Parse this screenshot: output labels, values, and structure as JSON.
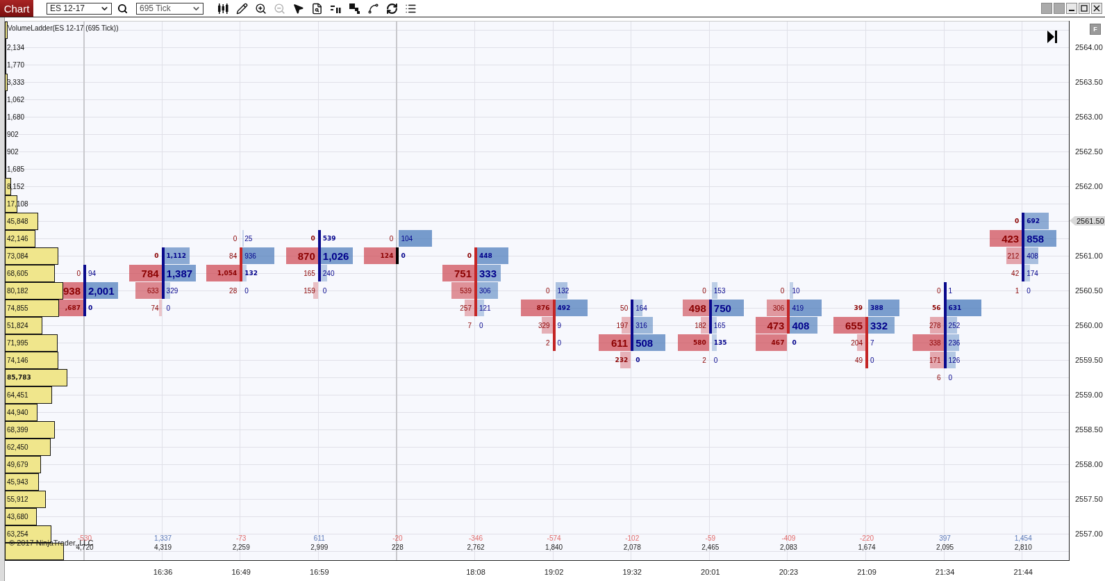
{
  "toolbar": {
    "chart_button": "Chart",
    "instrument": "ES 12-17",
    "interval": "695 Tick",
    "tools": [
      {
        "kind": "candles",
        "disabled": false
      },
      {
        "kind": "pencil",
        "disabled": false
      },
      {
        "kind": "zoom-in",
        "disabled": false
      },
      {
        "kind": "zoom-out",
        "disabled": true
      },
      {
        "kind": "pointer",
        "disabled": false
      },
      {
        "kind": "data-box",
        "disabled": false
      },
      {
        "kind": "ladder",
        "disabled": false
      },
      {
        "kind": "squares",
        "disabled": false
      },
      {
        "kind": "nodes",
        "disabled": false
      },
      {
        "kind": "refresh",
        "disabled": false
      },
      {
        "kind": "list",
        "disabled": false
      }
    ]
  },
  "chart": {
    "title": "VolumeLadder(ES 12-17 (695 Tick))",
    "flag_button": "F",
    "copyright": "© 2017 NinjaTrader, LLC",
    "price_axis": [
      {
        "price": "2564.00",
        "current": false
      },
      {
        "price": "2563.50",
        "current": false
      },
      {
        "price": "2563.00",
        "current": false
      },
      {
        "price": "2562.50",
        "current": false
      },
      {
        "price": "2562.00",
        "current": false
      },
      {
        "price": "2561.50",
        "current": true
      },
      {
        "price": "2561.00",
        "current": false
      },
      {
        "price": "2560.50",
        "current": false
      },
      {
        "price": "2560.00",
        "current": false
      },
      {
        "price": "2559.50",
        "current": false
      },
      {
        "price": "2559.00",
        "current": false
      },
      {
        "price": "2558.50",
        "current": false
      },
      {
        "price": "2558.00",
        "current": false
      },
      {
        "price": "2557.50",
        "current": false
      },
      {
        "price": "2557.00",
        "current": false
      }
    ],
    "profile": [
      {
        "level": 0.045
      },
      {
        "volume": "2,134",
        "level": 0.025,
        "poc": false
      },
      {
        "volume": "1,770",
        "level": 0.021,
        "poc": false
      },
      {
        "volume": "3,333",
        "level": 0.039,
        "poc": false
      },
      {
        "volume": "1,062",
        "level": 0.012,
        "poc": false
      },
      {
        "volume": "1,680",
        "level": 0.02,
        "poc": false
      },
      {
        "volume": "902",
        "level": 0.011,
        "poc": false
      },
      {
        "volume": "902",
        "level": 0.011,
        "poc": false
      },
      {
        "volume": "1,685",
        "level": 0.02,
        "poc": false
      },
      {
        "volume": "8,152",
        "level": 0.095,
        "poc": false
      },
      {
        "volume": "17,108",
        "level": 0.2,
        "poc": false
      },
      {
        "volume": "45,848",
        "level": 0.53,
        "poc": false
      },
      {
        "volume": "42,146",
        "level": 0.49,
        "poc": false
      },
      {
        "volume": "73,084",
        "level": 0.85,
        "poc": false
      },
      {
        "volume": "68,605",
        "level": 0.8,
        "poc": false
      },
      {
        "volume": "80,182",
        "level": 0.93,
        "poc": false
      },
      {
        "volume": "74,855",
        "level": 0.87,
        "poc": false
      },
      {
        "volume": "51,824",
        "level": 0.6,
        "poc": false
      },
      {
        "volume": "71,995",
        "level": 0.84,
        "poc": false
      },
      {
        "volume": "74,146",
        "level": 0.86,
        "poc": false
      },
      {
        "volume": "85,783",
        "level": 1,
        "poc": true
      },
      {
        "volume": "64,451",
        "level": 0.75,
        "poc": false
      },
      {
        "volume": "44,940",
        "level": 0.52,
        "poc": false
      },
      {
        "volume": "68,399",
        "level": 0.8,
        "poc": false
      },
      {
        "volume": "62,450",
        "level": 0.73,
        "poc": false
      },
      {
        "volume": "49,679",
        "level": 0.58,
        "poc": false
      },
      {
        "volume": "45,943",
        "level": 0.54,
        "poc": false
      },
      {
        "volume": "55,912",
        "level": 0.65,
        "poc": false
      },
      {
        "volume": "43,680",
        "level": 0.51,
        "poc": false
      },
      {
        "volume": "63,254",
        "level": 0.74,
        "poc": false
      },
      {
        "level": 0.94
      }
    ],
    "columns": [
      {
        "session_break": true,
        "kind": "up",
        "delta": "-530",
        "delta_positive": false,
        "volume": "4,720",
        "levels": [
          {
            "kind": "gap"
          },
          {
            "kind": "gap"
          },
          {
            "kind": "gap"
          },
          {
            "kind": "gap"
          },
          {
            "kind": "gap"
          },
          {
            "kind": "gap"
          },
          {
            "kind": "gap"
          },
          {
            "kind": "gap"
          },
          {
            "kind": "gap"
          },
          {
            "kind": "gap"
          },
          {
            "kind": "gap"
          },
          {
            "kind": "gap"
          },
          {
            "kind": "gap"
          },
          {
            "kind": "gap"
          },
          {
            "kind": "cell",
            "bid": {
              "text": "0"
            },
            "ask": {
              "text": "94"
            },
            "poc": false,
            "bold": false,
            "body": true
          },
          {
            "kind": "cell",
            "bid": {
              "text": "938",
              "level": 0.46
            },
            "ask": {
              "text": "2,001",
              "level": 0.46
            },
            "poc": true,
            "bold": true,
            "body": true
          },
          {
            "kind": "cell",
            "bid": {
              "text": ",687",
              "level": 0.46
            },
            "ask": {
              "text": "0"
            },
            "poc": false,
            "bold": true,
            "body": true
          }
        ]
      },
      {
        "time": "16:36",
        "session_break": false,
        "kind": "up",
        "delta": "1,337",
        "delta_positive": true,
        "volume": "4,319",
        "levels": [
          {
            "kind": "gap"
          },
          {
            "kind": "gap"
          },
          {
            "kind": "gap"
          },
          {
            "kind": "gap"
          },
          {
            "kind": "gap"
          },
          {
            "kind": "gap"
          },
          {
            "kind": "gap"
          },
          {
            "kind": "gap"
          },
          {
            "kind": "gap"
          },
          {
            "kind": "gap"
          },
          {
            "kind": "gap"
          },
          {
            "kind": "gap"
          },
          {
            "kind": "gap"
          },
          {
            "kind": "cell",
            "bid": {
              "text": "0"
            },
            "ask": {
              "text": "1,112",
              "level": 0.36
            },
            "poc": false,
            "bold": true,
            "body": true
          },
          {
            "kind": "cell",
            "bid": {
              "text": "784",
              "level": 0.47
            },
            "ask": {
              "text": "1,387",
              "level": 0.45
            },
            "poc": true,
            "bold": true,
            "body": true
          },
          {
            "kind": "cell",
            "bid": {
              "text": "633",
              "level": 0.38
            },
            "ask": {
              "text": "329",
              "level": 0.08
            },
            "poc": false,
            "bold": false,
            "body": true
          },
          {
            "kind": "cell",
            "bid": {
              "text": "74",
              "level": 0.04
            },
            "ask": {
              "text": "0"
            },
            "poc": false,
            "bold": false,
            "body": false
          }
        ]
      },
      {
        "time": "16:49",
        "session_break": false,
        "kind": "down",
        "delta": "-73",
        "delta_positive": false,
        "volume": "2,259",
        "levels": [
          {
            "kind": "gap"
          },
          {
            "kind": "gap"
          },
          {
            "kind": "gap"
          },
          {
            "kind": "gap"
          },
          {
            "kind": "gap"
          },
          {
            "kind": "gap"
          },
          {
            "kind": "gap"
          },
          {
            "kind": "gap"
          },
          {
            "kind": "gap"
          },
          {
            "kind": "gap"
          },
          {
            "kind": "gap"
          },
          {
            "kind": "gap"
          },
          {
            "kind": "cell",
            "bid": {
              "text": "0"
            },
            "ask": {
              "text": "25",
              "level": 0.02
            },
            "poc": false,
            "bold": false,
            "body": false
          },
          {
            "kind": "cell",
            "bid": {
              "text": "84"
            },
            "ask": {
              "text": "936",
              "level": 0.46
            },
            "poc": false,
            "bold": false,
            "body": true
          },
          {
            "kind": "cell",
            "bid": {
              "text": "1,054",
              "level": 0.48
            },
            "ask": {
              "text": "132",
              "level": 0.06
            },
            "poc": false,
            "bold": true,
            "body": true
          },
          {
            "kind": "cell",
            "bid": {
              "text": "28"
            },
            "ask": {
              "text": "0"
            },
            "poc": false,
            "bold": false,
            "body": false
          }
        ]
      },
      {
        "time": "16:59",
        "session_break": false,
        "kind": "up",
        "delta": "611",
        "delta_positive": true,
        "volume": "2,999",
        "levels": [
          {
            "kind": "gap"
          },
          {
            "kind": "gap"
          },
          {
            "kind": "gap"
          },
          {
            "kind": "gap"
          },
          {
            "kind": "gap"
          },
          {
            "kind": "gap"
          },
          {
            "kind": "gap"
          },
          {
            "kind": "gap"
          },
          {
            "kind": "gap"
          },
          {
            "kind": "gap"
          },
          {
            "kind": "gap"
          },
          {
            "kind": "gap"
          },
          {
            "kind": "cell",
            "bid": {
              "text": "0"
            },
            "ask": {
              "text": "539"
            },
            "poc": false,
            "bold": true,
            "body": true
          },
          {
            "kind": "cell",
            "bid": {
              "text": "870",
              "level": 0.46
            },
            "ask": {
              "text": "1,026",
              "level": 0.46
            },
            "poc": true,
            "bold": true,
            "body": true
          },
          {
            "kind": "cell",
            "bid": {
              "text": "165"
            },
            "ask": {
              "text": "240",
              "level": 0.09
            },
            "poc": false,
            "bold": false,
            "body": true
          },
          {
            "kind": "cell",
            "bid": {
              "text": "159",
              "level": 0.07
            },
            "ask": {
              "text": "0"
            },
            "poc": false,
            "bold": false,
            "body": false
          }
        ]
      },
      {
        "session_break": true,
        "kind": "flat",
        "delta": "-20",
        "delta_positive": false,
        "volume": "228",
        "levels": [
          {
            "kind": "gap"
          },
          {
            "kind": "gap"
          },
          {
            "kind": "gap"
          },
          {
            "kind": "gap"
          },
          {
            "kind": "gap"
          },
          {
            "kind": "gap"
          },
          {
            "kind": "gap"
          },
          {
            "kind": "gap"
          },
          {
            "kind": "gap"
          },
          {
            "kind": "gap"
          },
          {
            "kind": "gap"
          },
          {
            "kind": "gap"
          },
          {
            "kind": "cell",
            "bid": {
              "text": "0"
            },
            "ask": {
              "text": "104",
              "level": 0.48
            },
            "poc": false,
            "bold": false,
            "body": false
          },
          {
            "kind": "cell",
            "bid": {
              "text": "124",
              "level": 0.46
            },
            "ask": {
              "text": "0"
            },
            "poc": false,
            "bold": true,
            "body": true
          }
        ]
      },
      {
        "time": "18:08",
        "session_break": false,
        "kind": "down",
        "delta": "-346",
        "delta_positive": false,
        "volume": "2,762",
        "levels": [
          {
            "kind": "gap"
          },
          {
            "kind": "gap"
          },
          {
            "kind": "gap"
          },
          {
            "kind": "gap"
          },
          {
            "kind": "gap"
          },
          {
            "kind": "gap"
          },
          {
            "kind": "gap"
          },
          {
            "kind": "gap"
          },
          {
            "kind": "gap"
          },
          {
            "kind": "gap"
          },
          {
            "kind": "gap"
          },
          {
            "kind": "gap"
          },
          {
            "kind": "gap"
          },
          {
            "kind": "cell",
            "bid": {
              "text": "0"
            },
            "ask": {
              "text": "448",
              "level": 0.45
            },
            "poc": false,
            "bold": true,
            "body": true
          },
          {
            "kind": "cell",
            "bid": {
              "text": "751",
              "level": 0.46
            },
            "ask": {
              "text": "333",
              "level": 0.34
            },
            "poc": true,
            "bold": true,
            "body": true
          },
          {
            "kind": "cell",
            "bid": {
              "text": "539",
              "level": 0.33
            },
            "ask": {
              "text": "306",
              "level": 0.3
            },
            "poc": false,
            "bold": false,
            "body": true
          },
          {
            "kind": "cell",
            "bid": {
              "text": "257",
              "level": 0.14
            },
            "ask": {
              "text": "121",
              "level": 0.1
            },
            "poc": false,
            "bold": false,
            "body": true
          },
          {
            "kind": "cell",
            "bid": {
              "text": "7"
            },
            "ask": {
              "text": "0"
            },
            "poc": false,
            "bold": false,
            "body": false
          }
        ]
      },
      {
        "time": "19:02",
        "session_break": false,
        "kind": "down",
        "delta": "-574",
        "delta_positive": false,
        "volume": "1,840",
        "levels": [
          {
            "kind": "gap"
          },
          {
            "kind": "gap"
          },
          {
            "kind": "gap"
          },
          {
            "kind": "gap"
          },
          {
            "kind": "gap"
          },
          {
            "kind": "gap"
          },
          {
            "kind": "gap"
          },
          {
            "kind": "gap"
          },
          {
            "kind": "gap"
          },
          {
            "kind": "gap"
          },
          {
            "kind": "gap"
          },
          {
            "kind": "gap"
          },
          {
            "kind": "gap"
          },
          {
            "kind": "gap"
          },
          {
            "kind": "gap"
          },
          {
            "kind": "cell",
            "bid": {
              "text": "0"
            },
            "ask": {
              "text": "132",
              "level": 0.17
            },
            "poc": false,
            "bold": false,
            "body": false
          },
          {
            "kind": "cell",
            "bid": {
              "text": "876",
              "level": 0.46
            },
            "ask": {
              "text": "492",
              "level": 0.46
            },
            "poc": false,
            "bold": true,
            "body": true
          },
          {
            "kind": "cell",
            "bid": {
              "text": "329",
              "level": 0.16
            },
            "ask": {
              "text": "9"
            },
            "poc": false,
            "bold": false,
            "body": true
          },
          {
            "kind": "cell",
            "bid": {
              "text": "2"
            },
            "ask": {
              "text": "0"
            },
            "poc": false,
            "bold": false,
            "body": true
          }
        ]
      },
      {
        "time": "19:32",
        "session_break": false,
        "kind": "up",
        "delta": "-102",
        "delta_positive": false,
        "volume": "2,078",
        "levels": [
          {
            "kind": "gap"
          },
          {
            "kind": "gap"
          },
          {
            "kind": "gap"
          },
          {
            "kind": "gap"
          },
          {
            "kind": "gap"
          },
          {
            "kind": "gap"
          },
          {
            "kind": "gap"
          },
          {
            "kind": "gap"
          },
          {
            "kind": "gap"
          },
          {
            "kind": "gap"
          },
          {
            "kind": "gap"
          },
          {
            "kind": "gap"
          },
          {
            "kind": "gap"
          },
          {
            "kind": "gap"
          },
          {
            "kind": "gap"
          },
          {
            "kind": "gap"
          },
          {
            "kind": "cell",
            "bid": {
              "text": "50"
            },
            "ask": {
              "text": "164",
              "level": 0.13
            },
            "poc": false,
            "bold": false,
            "body": true
          },
          {
            "kind": "cell",
            "bid": {
              "text": "197",
              "level": 0.13
            },
            "ask": {
              "text": "316",
              "level": 0.28
            },
            "poc": false,
            "bold": false,
            "body": true
          },
          {
            "kind": "cell",
            "bid": {
              "text": "611",
              "level": 0.46
            },
            "ask": {
              "text": "508",
              "level": 0.46
            },
            "poc": true,
            "bold": true,
            "body": true
          },
          {
            "kind": "cell",
            "bid": {
              "text": "232",
              "level": 0.15
            },
            "ask": {
              "text": "0"
            },
            "poc": false,
            "bold": true,
            "body": false
          }
        ]
      },
      {
        "time": "20:01",
        "session_break": false,
        "kind": "up",
        "delta": "-59",
        "delta_positive": false,
        "volume": "2,465",
        "levels": [
          {
            "kind": "gap"
          },
          {
            "kind": "gap"
          },
          {
            "kind": "gap"
          },
          {
            "kind": "gap"
          },
          {
            "kind": "gap"
          },
          {
            "kind": "gap"
          },
          {
            "kind": "gap"
          },
          {
            "kind": "gap"
          },
          {
            "kind": "gap"
          },
          {
            "kind": "gap"
          },
          {
            "kind": "gap"
          },
          {
            "kind": "gap"
          },
          {
            "kind": "gap"
          },
          {
            "kind": "gap"
          },
          {
            "kind": "gap"
          },
          {
            "kind": "cell",
            "bid": {
              "text": "0"
            },
            "ask": {
              "text": "153",
              "level": 0.08
            },
            "poc": false,
            "bold": false,
            "body": false
          },
          {
            "kind": "cell",
            "bid": {
              "text": "498",
              "level": 0.38
            },
            "ask": {
              "text": "750",
              "level": 0.46
            },
            "poc": true,
            "bold": true,
            "body": true
          },
          {
            "kind": "cell",
            "bid": {
              "text": "182",
              "level": 0.12
            },
            "ask": {
              "text": "165",
              "level": 0.07
            },
            "poc": false,
            "bold": false,
            "body": true
          },
          {
            "kind": "cell",
            "bid": {
              "text": "580",
              "level": 0.45
            },
            "ask": {
              "text": "135",
              "level": 0.07
            },
            "poc": false,
            "bold": true,
            "body": false
          },
          {
            "kind": "cell",
            "bid": {
              "text": "2"
            },
            "ask": {
              "text": "0"
            },
            "poc": false,
            "bold": false,
            "body": false
          }
        ]
      },
      {
        "time": "20:23",
        "session_break": false,
        "kind": "down",
        "delta": "-409",
        "delta_positive": false,
        "volume": "2,083",
        "levels": [
          {
            "kind": "gap"
          },
          {
            "kind": "gap"
          },
          {
            "kind": "gap"
          },
          {
            "kind": "gap"
          },
          {
            "kind": "gap"
          },
          {
            "kind": "gap"
          },
          {
            "kind": "gap"
          },
          {
            "kind": "gap"
          },
          {
            "kind": "gap"
          },
          {
            "kind": "gap"
          },
          {
            "kind": "gap"
          },
          {
            "kind": "gap"
          },
          {
            "kind": "gap"
          },
          {
            "kind": "gap"
          },
          {
            "kind": "gap"
          },
          {
            "kind": "cell",
            "bid": {
              "text": "0"
            },
            "ask": {
              "text": "10",
              "level": 0.05
            },
            "poc": false,
            "bold": false,
            "body": false
          },
          {
            "kind": "cell",
            "bid": {
              "text": "306",
              "level": 0.29
            },
            "ask": {
              "text": "419",
              "level": 0.46
            },
            "poc": false,
            "bold": false,
            "body": true
          },
          {
            "kind": "cell",
            "bid": {
              "text": "473",
              "level": 0.45
            },
            "ask": {
              "text": "408",
              "level": 0.4
            },
            "poc": true,
            "bold": true,
            "body": true
          },
          {
            "kind": "cell",
            "bid": {
              "text": "467",
              "level": 0.45
            },
            "ask": {
              "text": "0"
            },
            "poc": false,
            "bold": true,
            "body": false
          }
        ]
      },
      {
        "time": "21:09",
        "session_break": false,
        "kind": "down",
        "delta": "-220",
        "delta_positive": false,
        "volume": "1,674",
        "levels": [
          {
            "kind": "gap"
          },
          {
            "kind": "gap"
          },
          {
            "kind": "gap"
          },
          {
            "kind": "gap"
          },
          {
            "kind": "gap"
          },
          {
            "kind": "gap"
          },
          {
            "kind": "gap"
          },
          {
            "kind": "gap"
          },
          {
            "kind": "gap"
          },
          {
            "kind": "gap"
          },
          {
            "kind": "gap"
          },
          {
            "kind": "gap"
          },
          {
            "kind": "gap"
          },
          {
            "kind": "gap"
          },
          {
            "kind": "gap"
          },
          {
            "kind": "gap"
          },
          {
            "kind": "cell",
            "bid": {
              "text": "39"
            },
            "ask": {
              "text": "388",
              "level": 0.45
            },
            "poc": false,
            "bold": true,
            "body": false
          },
          {
            "kind": "cell",
            "bid": {
              "text": "655",
              "level": 0.46
            },
            "ask": {
              "text": "332",
              "level": 0.38
            },
            "poc": true,
            "bold": true,
            "body": true
          },
          {
            "kind": "cell",
            "bid": {
              "text": "204",
              "level": 0.12
            },
            "ask": {
              "text": "7"
            },
            "poc": false,
            "bold": false,
            "body": true
          },
          {
            "kind": "cell",
            "bid": {
              "text": "49"
            },
            "ask": {
              "text": "0"
            },
            "poc": false,
            "bold": false,
            "body": true
          }
        ]
      },
      {
        "time": "21:34",
        "session_break": false,
        "kind": "up",
        "delta": "397",
        "delta_positive": true,
        "volume": "2,095",
        "levels": [
          {
            "kind": "gap"
          },
          {
            "kind": "gap"
          },
          {
            "kind": "gap"
          },
          {
            "kind": "gap"
          },
          {
            "kind": "gap"
          },
          {
            "kind": "gap"
          },
          {
            "kind": "gap"
          },
          {
            "kind": "gap"
          },
          {
            "kind": "gap"
          },
          {
            "kind": "gap"
          },
          {
            "kind": "gap"
          },
          {
            "kind": "gap"
          },
          {
            "kind": "gap"
          },
          {
            "kind": "gap"
          },
          {
            "kind": "gap"
          },
          {
            "kind": "cell",
            "bid": {
              "text": "0"
            },
            "ask": {
              "text": "1"
            },
            "poc": false,
            "bold": false,
            "body": true
          },
          {
            "kind": "cell",
            "bid": {
              "text": "56"
            },
            "ask": {
              "text": "631",
              "level": 0.5
            },
            "poc": false,
            "bold": true,
            "body": true
          },
          {
            "kind": "cell",
            "bid": {
              "text": "278",
              "level": 0.2
            },
            "ask": {
              "text": "252",
              "level": 0.15
            },
            "poc": false,
            "bold": false,
            "body": true
          },
          {
            "kind": "cell",
            "bid": {
              "text": "338",
              "level": 0.45
            },
            "ask": {
              "text": "236",
              "level": 0.18
            },
            "poc": false,
            "bold": false,
            "body": true
          },
          {
            "kind": "cell",
            "bid": {
              "text": "171",
              "level": 0.2
            },
            "ask": {
              "text": "126",
              "level": 0.13
            },
            "poc": false,
            "bold": false,
            "body": true
          },
          {
            "kind": "cell",
            "bid": {
              "text": "6"
            },
            "ask": {
              "text": "0"
            },
            "poc": false,
            "bold": false,
            "body": false
          }
        ]
      },
      {
        "time": "21:44",
        "session_break": false,
        "kind": "up",
        "delta": "1,454",
        "delta_positive": true,
        "volume": "2,810",
        "levels": [
          {
            "kind": "gap"
          },
          {
            "kind": "gap"
          },
          {
            "kind": "gap"
          },
          {
            "kind": "gap"
          },
          {
            "kind": "gap"
          },
          {
            "kind": "gap"
          },
          {
            "kind": "gap"
          },
          {
            "kind": "gap"
          },
          {
            "kind": "gap"
          },
          {
            "kind": "gap"
          },
          {
            "kind": "gap"
          },
          {
            "kind": "cell",
            "bid": {
              "text": "0"
            },
            "ask": {
              "text": "692",
              "level": 0.35
            },
            "poc": false,
            "bold": true,
            "body": true
          },
          {
            "kind": "cell",
            "bid": {
              "text": "423",
              "level": 0.46
            },
            "ask": {
              "text": "858",
              "level": 0.46
            },
            "poc": true,
            "bold": true,
            "body": true
          },
          {
            "kind": "cell",
            "bid": {
              "text": "212",
              "level": 0.22
            },
            "ask": {
              "text": "408",
              "level": 0.2
            },
            "poc": false,
            "bold": false,
            "body": true
          },
          {
            "kind": "cell",
            "bid": {
              "text": "42"
            },
            "ask": {
              "text": "174",
              "level": 0.08
            },
            "poc": false,
            "bold": false,
            "body": true
          },
          {
            "kind": "cell",
            "bid": {
              "text": "1"
            },
            "ask": {
              "text": "0"
            },
            "poc": false,
            "bold": false,
            "body": false
          }
        ]
      }
    ]
  }
}
